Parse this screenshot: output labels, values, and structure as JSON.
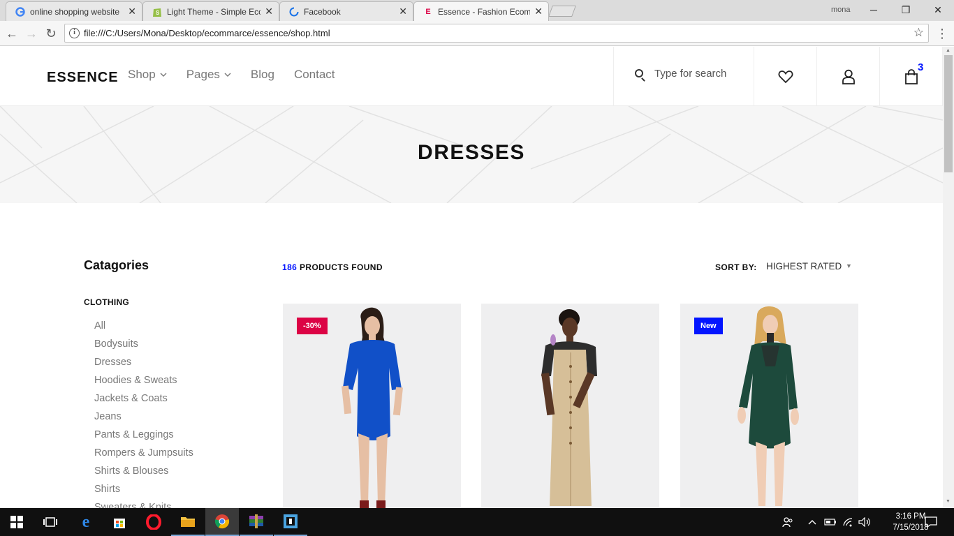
{
  "browser": {
    "tabs": [
      {
        "title": "online shopping website",
        "favicon": "google-icon"
      },
      {
        "title": "Light Theme - Simple Ecc",
        "favicon": "shopify-icon"
      },
      {
        "title": "Facebook",
        "favicon": "loading-spinner-icon"
      },
      {
        "title": "Essence - Fashion Ecomm",
        "favicon": "essence-icon",
        "active": true
      }
    ],
    "profile_name": "mona",
    "url": "file:///C:/Users/Mona/Desktop/ecommarce/essence/shop.html"
  },
  "site": {
    "logo": "ESSENCE",
    "nav": [
      {
        "label": "Shop",
        "dropdown": true
      },
      {
        "label": "Pages",
        "dropdown": true
      },
      {
        "label": "Blog",
        "dropdown": false
      },
      {
        "label": "Contact",
        "dropdown": false
      }
    ],
    "search_placeholder": "Type for search",
    "cart_count": "3"
  },
  "banner": {
    "title": "DRESSES"
  },
  "sidebar": {
    "title": "Catagories",
    "group": "CLOTHING",
    "items": [
      "All",
      "Bodysuits",
      "Dresses",
      "Hoodies & Sweats",
      "Jackets & Coats",
      "Jeans",
      "Pants & Leggings",
      "Rompers & Jumpsuits",
      "Shirts & Blouses",
      "Shirts",
      "Sweaters & Knits"
    ]
  },
  "products": {
    "count": "186",
    "found_label": "PRODUCTS FOUND",
    "sort_label": "SORT BY:",
    "sort_value": "HIGHEST RATED",
    "items": [
      {
        "badge": "-30%",
        "badge_type": "sale",
        "dress_color": "#1150c8"
      },
      {
        "badge": "",
        "badge_type": "none",
        "dress_color": "#d6bf98"
      },
      {
        "badge": "New",
        "badge_type": "new",
        "dress_color": "#1d4a3c"
      }
    ]
  },
  "colors": {
    "accent_blue": "#0315ff",
    "sale_red": "#dc0345"
  },
  "taskbar": {
    "apps": [
      "start-icon",
      "task-view-icon",
      "edge-icon",
      "store-icon",
      "opera-icon",
      "file-explorer-icon",
      "chrome-icon",
      "winrar-icon",
      "app-icon"
    ],
    "time": "3:16 PM",
    "date": "7/15/2018"
  }
}
